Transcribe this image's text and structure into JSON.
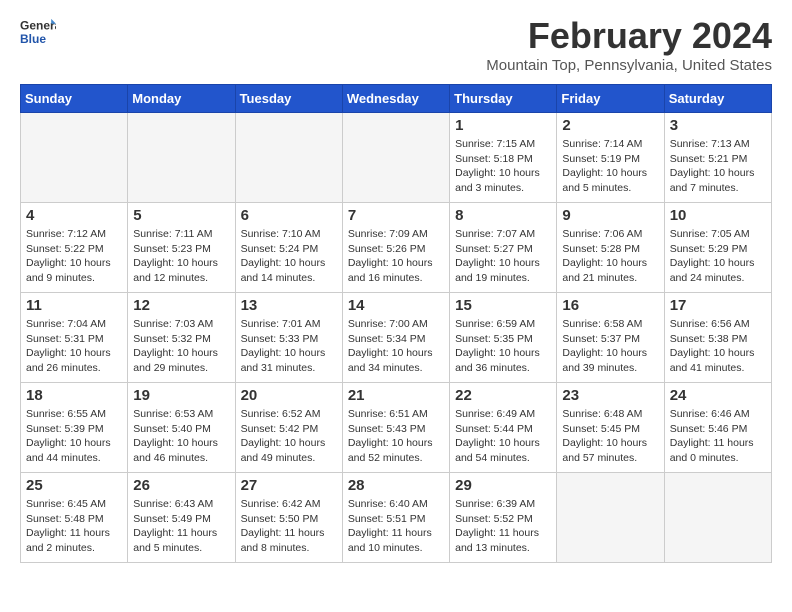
{
  "logo": {
    "general": "General",
    "blue": "Blue"
  },
  "title": "February 2024",
  "subtitle": "Mountain Top, Pennsylvania, United States",
  "days_of_week": [
    "Sunday",
    "Monday",
    "Tuesday",
    "Wednesday",
    "Thursday",
    "Friday",
    "Saturday"
  ],
  "weeks": [
    [
      {
        "day": "",
        "info": "",
        "empty": true
      },
      {
        "day": "",
        "info": "",
        "empty": true
      },
      {
        "day": "",
        "info": "",
        "empty": true
      },
      {
        "day": "",
        "info": "",
        "empty": true
      },
      {
        "day": "1",
        "info": "Sunrise: 7:15 AM\nSunset: 5:18 PM\nDaylight: 10 hours\nand 3 minutes."
      },
      {
        "day": "2",
        "info": "Sunrise: 7:14 AM\nSunset: 5:19 PM\nDaylight: 10 hours\nand 5 minutes."
      },
      {
        "day": "3",
        "info": "Sunrise: 7:13 AM\nSunset: 5:21 PM\nDaylight: 10 hours\nand 7 minutes."
      }
    ],
    [
      {
        "day": "4",
        "info": "Sunrise: 7:12 AM\nSunset: 5:22 PM\nDaylight: 10 hours\nand 9 minutes."
      },
      {
        "day": "5",
        "info": "Sunrise: 7:11 AM\nSunset: 5:23 PM\nDaylight: 10 hours\nand 12 minutes."
      },
      {
        "day": "6",
        "info": "Sunrise: 7:10 AM\nSunset: 5:24 PM\nDaylight: 10 hours\nand 14 minutes."
      },
      {
        "day": "7",
        "info": "Sunrise: 7:09 AM\nSunset: 5:26 PM\nDaylight: 10 hours\nand 16 minutes."
      },
      {
        "day": "8",
        "info": "Sunrise: 7:07 AM\nSunset: 5:27 PM\nDaylight: 10 hours\nand 19 minutes."
      },
      {
        "day": "9",
        "info": "Sunrise: 7:06 AM\nSunset: 5:28 PM\nDaylight: 10 hours\nand 21 minutes."
      },
      {
        "day": "10",
        "info": "Sunrise: 7:05 AM\nSunset: 5:29 PM\nDaylight: 10 hours\nand 24 minutes."
      }
    ],
    [
      {
        "day": "11",
        "info": "Sunrise: 7:04 AM\nSunset: 5:31 PM\nDaylight: 10 hours\nand 26 minutes."
      },
      {
        "day": "12",
        "info": "Sunrise: 7:03 AM\nSunset: 5:32 PM\nDaylight: 10 hours\nand 29 minutes."
      },
      {
        "day": "13",
        "info": "Sunrise: 7:01 AM\nSunset: 5:33 PM\nDaylight: 10 hours\nand 31 minutes."
      },
      {
        "day": "14",
        "info": "Sunrise: 7:00 AM\nSunset: 5:34 PM\nDaylight: 10 hours\nand 34 minutes."
      },
      {
        "day": "15",
        "info": "Sunrise: 6:59 AM\nSunset: 5:35 PM\nDaylight: 10 hours\nand 36 minutes."
      },
      {
        "day": "16",
        "info": "Sunrise: 6:58 AM\nSunset: 5:37 PM\nDaylight: 10 hours\nand 39 minutes."
      },
      {
        "day": "17",
        "info": "Sunrise: 6:56 AM\nSunset: 5:38 PM\nDaylight: 10 hours\nand 41 minutes."
      }
    ],
    [
      {
        "day": "18",
        "info": "Sunrise: 6:55 AM\nSunset: 5:39 PM\nDaylight: 10 hours\nand 44 minutes."
      },
      {
        "day": "19",
        "info": "Sunrise: 6:53 AM\nSunset: 5:40 PM\nDaylight: 10 hours\nand 46 minutes."
      },
      {
        "day": "20",
        "info": "Sunrise: 6:52 AM\nSunset: 5:42 PM\nDaylight: 10 hours\nand 49 minutes."
      },
      {
        "day": "21",
        "info": "Sunrise: 6:51 AM\nSunset: 5:43 PM\nDaylight: 10 hours\nand 52 minutes."
      },
      {
        "day": "22",
        "info": "Sunrise: 6:49 AM\nSunset: 5:44 PM\nDaylight: 10 hours\nand 54 minutes."
      },
      {
        "day": "23",
        "info": "Sunrise: 6:48 AM\nSunset: 5:45 PM\nDaylight: 10 hours\nand 57 minutes."
      },
      {
        "day": "24",
        "info": "Sunrise: 6:46 AM\nSunset: 5:46 PM\nDaylight: 11 hours\nand 0 minutes."
      }
    ],
    [
      {
        "day": "25",
        "info": "Sunrise: 6:45 AM\nSunset: 5:48 PM\nDaylight: 11 hours\nand 2 minutes."
      },
      {
        "day": "26",
        "info": "Sunrise: 6:43 AM\nSunset: 5:49 PM\nDaylight: 11 hours\nand 5 minutes."
      },
      {
        "day": "27",
        "info": "Sunrise: 6:42 AM\nSunset: 5:50 PM\nDaylight: 11 hours\nand 8 minutes."
      },
      {
        "day": "28",
        "info": "Sunrise: 6:40 AM\nSunset: 5:51 PM\nDaylight: 11 hours\nand 10 minutes."
      },
      {
        "day": "29",
        "info": "Sunrise: 6:39 AM\nSunset: 5:52 PM\nDaylight: 11 hours\nand 13 minutes."
      },
      {
        "day": "",
        "info": "",
        "empty": true
      },
      {
        "day": "",
        "info": "",
        "empty": true
      }
    ]
  ]
}
